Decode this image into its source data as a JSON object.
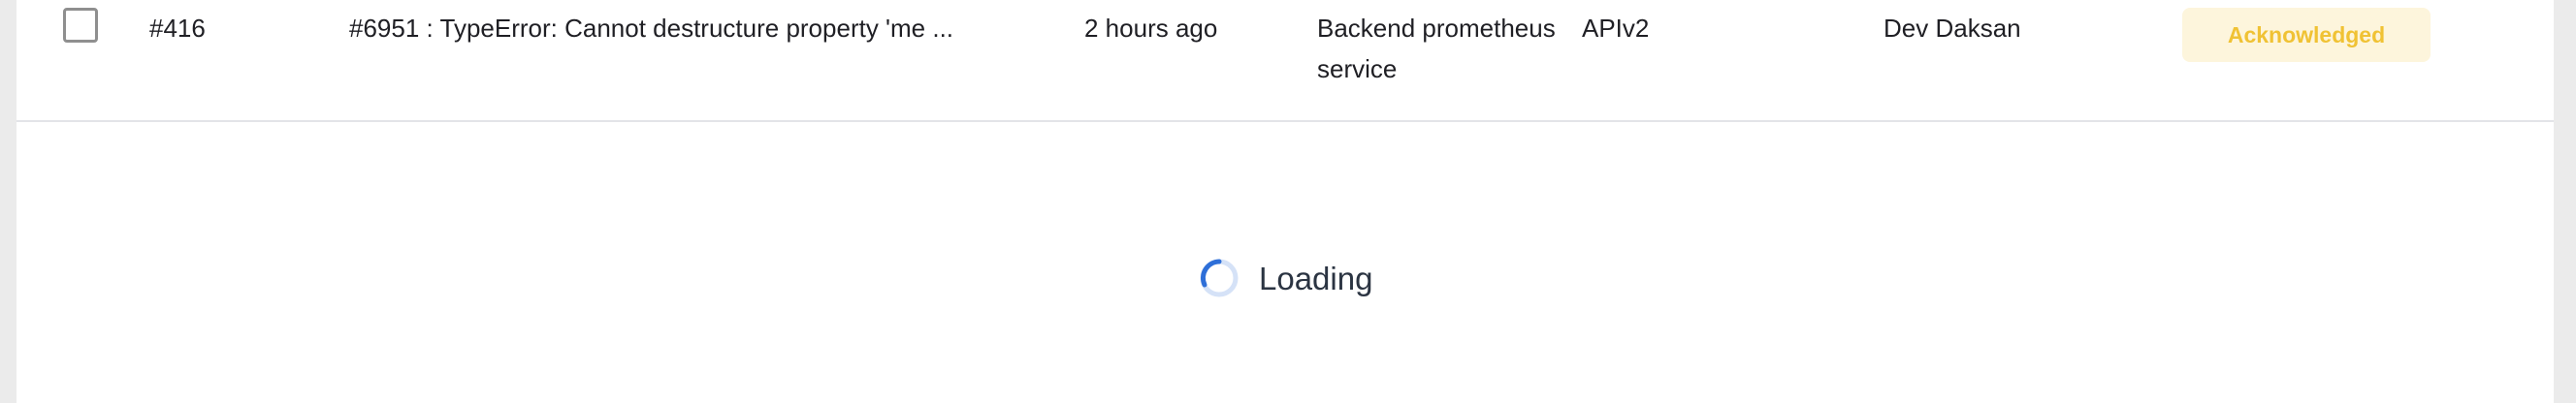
{
  "row": {
    "id": "#416",
    "title": "#6951 : TypeError: Cannot destructure property 'me ...",
    "time": "2 hours ago",
    "service": "Backend prometheus service",
    "environment": "APIv2",
    "assignee": "Dev Daksan",
    "status": "Acknowledged"
  },
  "loading": {
    "label": "Loading",
    "icon": "spinner-icon"
  },
  "colors": {
    "status_bg": "#fdf5dc",
    "status_text": "#f0c234",
    "spinner_active": "#2e6fd8",
    "spinner_track": "#d5e2f7"
  }
}
